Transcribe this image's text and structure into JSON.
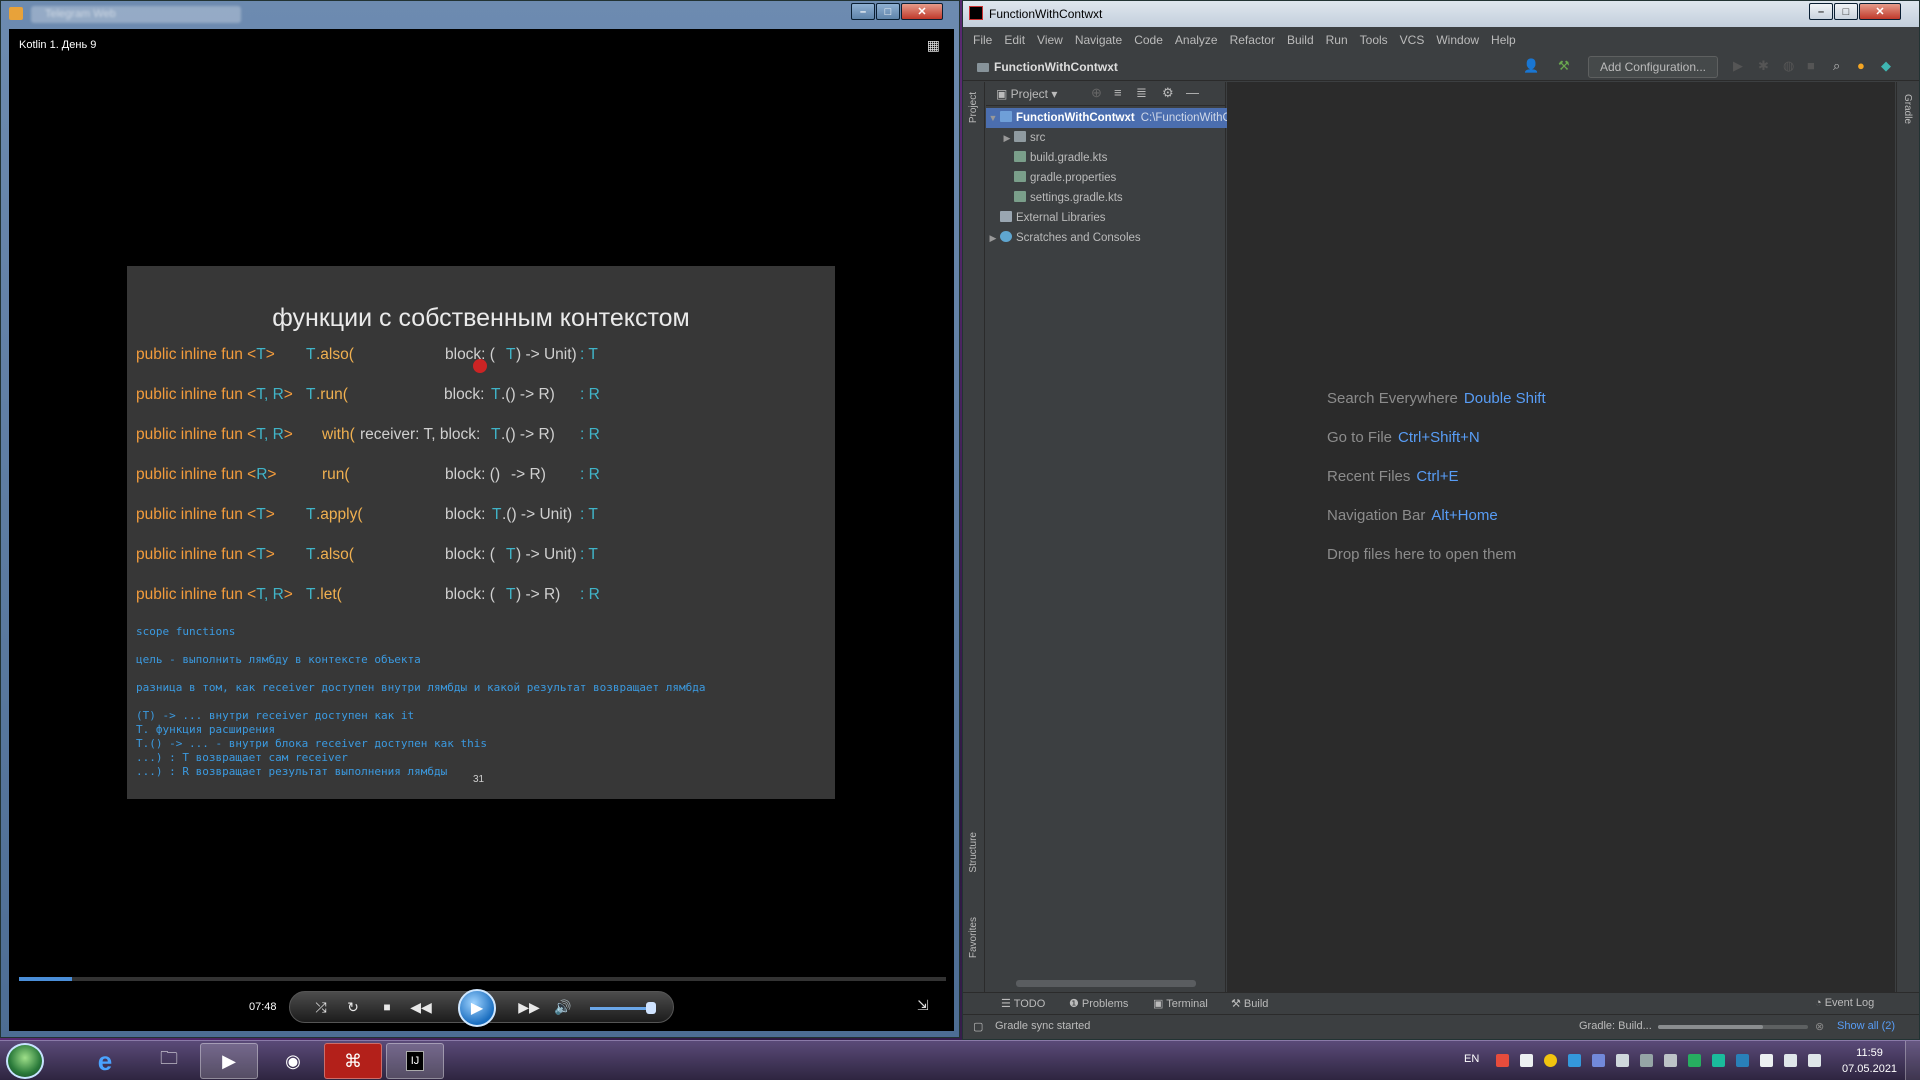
{
  "player": {
    "video_title": "Kotlin 1. День 9",
    "time": "07:48",
    "progress_fraction": 0.057,
    "volume_fraction": 0.85
  },
  "slide": {
    "title": "функции с собственным контекстом",
    "lines": [
      {
        "a": "public inline fun <",
        "b": "T",
        "c": ">",
        "d": "T",
        "e": ".also(",
        "f": "block: (",
        "g": "T",
        "h": ") -> Unit)",
        "i": ": T"
      },
      {
        "a": "public inline fun <",
        "b": "T, R",
        "c": ">",
        "d": "T",
        "e": ".run(",
        "f": "block: ",
        "g": "T",
        "h": ".() -> R)",
        "i": ": R"
      },
      {
        "a": "public inline fun <",
        "b": "T, R",
        "c": ">",
        "d": "",
        "e": "with(",
        "f": "receiver: T, block: ",
        "g": "T",
        "h": ".() -> R)",
        "i": ": R"
      },
      {
        "a": "public inline fun <",
        "b": "R",
        "c": ">",
        "d": "",
        "e": "run(",
        "f": "block: () ",
        "g": "",
        "h": "-> R)",
        "i": ": R"
      },
      {
        "a": "public inline fun <",
        "b": "T",
        "c": ">",
        "d": "T",
        "e": ".apply(",
        "f": "block: ",
        "g": "T",
        "h": ".() -> Unit)",
        "i": ": T"
      },
      {
        "a": "public inline fun <",
        "b": "T",
        "c": ">",
        "d": "T",
        "e": ".also(",
        "f": "block: (",
        "g": "T",
        "h": ") -> Unit)",
        "i": ": T"
      },
      {
        "a": "public inline fun <",
        "b": "T, R",
        "c": ">",
        "d": "T",
        "e": ".let(",
        "f": "block: (",
        "g": "T",
        "h": ") -> R)",
        "i": ": R"
      }
    ],
    "notes": {
      "n1": "scope functions",
      "n2": "цель - выполнить лямбду в контексте объекта",
      "n3": "разница в том, как receiver доступен внутри лямбды и какой результат возвращает лямбда",
      "n4": "(T) -> ... внутри receiver доступен как it",
      "n5": "T. функция расширения",
      "n6": "T.() -> ... - внутри блока receiver доступен как this",
      "n7": "...) : T возвращает сам receiver",
      "n8": "...) : R возвращает результат выполнения лямбды"
    },
    "page_number": "31"
  },
  "ide": {
    "window_title": "FunctionWithContwxt",
    "menu": [
      "File",
      "Edit",
      "View",
      "Navigate",
      "Code",
      "Analyze",
      "Refactor",
      "Build",
      "Run",
      "Tools",
      "VCS",
      "Window",
      "Help"
    ],
    "breadcrumb": "FunctionWithContwxt",
    "add_configuration": "Add Configuration...",
    "project_label": "Project",
    "tree": {
      "root": "FunctionWithContwxt",
      "root_path": "C:\\FunctionWithContwxt",
      "src": "src",
      "build_gradle": "build.gradle.kts",
      "gradle_properties": "gradle.properties",
      "settings_gradle": "settings.gradle.kts",
      "external_libraries": "External Libraries",
      "scratches": "Scratches and Consoles"
    },
    "left_tabs": {
      "project": "Project",
      "structure": "Structure",
      "favorites": "Favorites"
    },
    "right_tabs": {
      "gradle": "Gradle"
    },
    "hints": [
      {
        "label": "Search Everywhere",
        "key": "Double Shift"
      },
      {
        "label": "Go to File",
        "key": "Ctrl+Shift+N"
      },
      {
        "label": "Recent Files",
        "key": "Ctrl+E"
      },
      {
        "label": "Navigation Bar",
        "key": "Alt+Home"
      },
      {
        "label": "Drop files here to open them",
        "key": ""
      }
    ],
    "tool_tabs": {
      "todo": "TODO",
      "problems": "Problems",
      "terminal": "Terminal",
      "build": "Build",
      "event_log": "Event Log"
    },
    "status": {
      "message": "Gradle sync started",
      "task": "Gradle: Build...",
      "show_all": "Show all (2)",
      "progress_fraction": 0.7
    }
  },
  "taskbar": {
    "language": "EN",
    "time": "11:59",
    "date": "07.05.2021"
  }
}
